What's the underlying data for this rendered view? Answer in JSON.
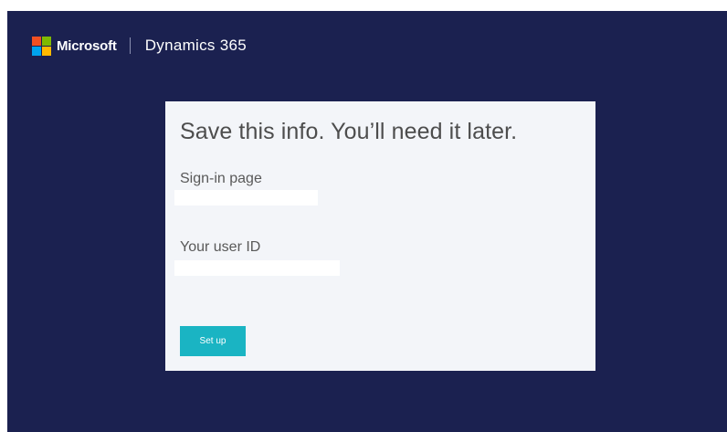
{
  "header": {
    "brand": "Microsoft",
    "product": "Dynamics 365",
    "logo_icon": "microsoft-logo-icon",
    "logo_colors": [
      "#f25022",
      "#7fba00",
      "#00a4ef",
      "#ffb900"
    ]
  },
  "card": {
    "title": "Save this info. You’ll need it later.",
    "sign_in_label": "Sign-in page",
    "sign_in_value": "",
    "user_id_label": "Your user ID",
    "user_id_value": "",
    "setup_button": "Set up"
  },
  "colors": {
    "background": "#1b2150",
    "card": "#f3f5f9",
    "button": "#1ab4c3"
  }
}
